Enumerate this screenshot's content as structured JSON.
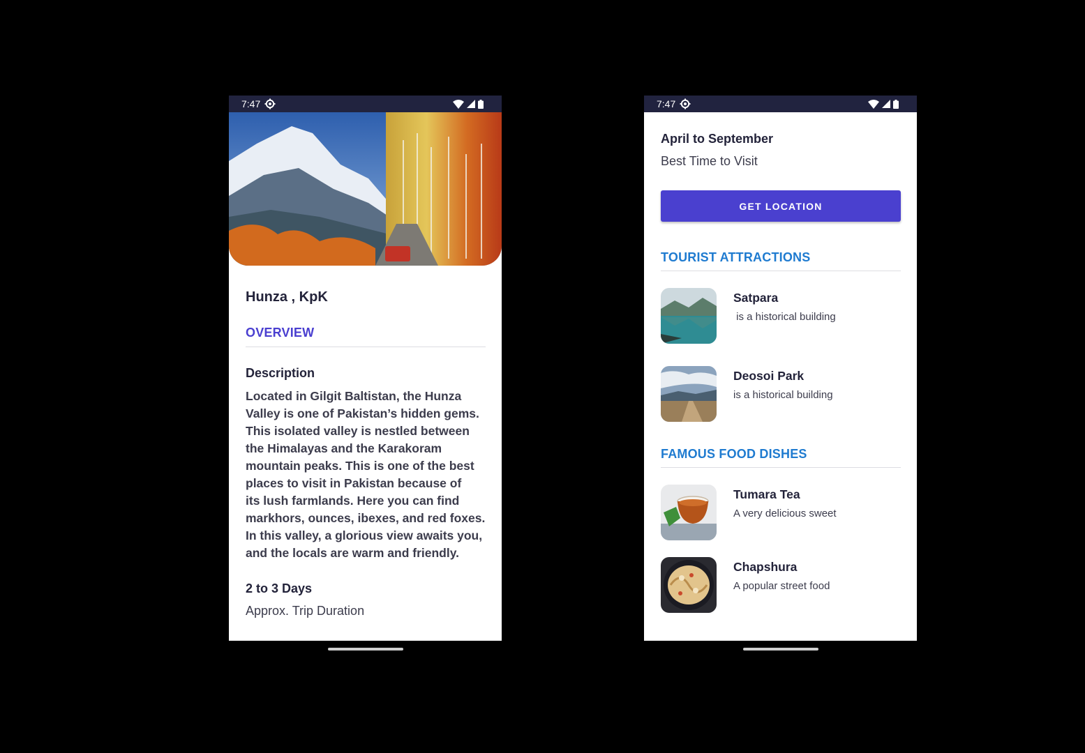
{
  "status_bar": {
    "time": "7:47"
  },
  "left_screen": {
    "hero_image": "Hunza valley mountains with autumn trees",
    "title": "Hunza , KpK",
    "overview_heading": "OVERVIEW",
    "description_label": "Description",
    "description_text": "Located in Gilgit Baltistan, the Hunza\nValley is one of Pakistan’s hidden gems.\nThis isolated valley is nestled between\nthe Himalayas and the Karakoram\nmountain peaks. This is one of the best\nplaces to visit in Pakistan because of\nits lush farmlands. Here you can find\nmarkhors, ounces, ibexes, and red foxes.\nIn this valley, a glorious view awaits you,\nand the locals are warm and friendly.",
    "trip_duration_value": "2 to 3 Days",
    "trip_duration_label": "Approx. Trip Duration"
  },
  "right_screen": {
    "best_time_value": "April to September",
    "best_time_label": "Best Time to Visit",
    "get_location_label": "GET LOCATION",
    "attractions_heading": "TOURIST ATTRACTIONS",
    "attractions": [
      {
        "name": "Satpara",
        "subtitle": " is a historical building",
        "thumb": "lake-photo"
      },
      {
        "name": "Deosoi Park",
        "subtitle": "is a historical building",
        "thumb": "plain-photo"
      }
    ],
    "food_heading": "FAMOUS FOOD DISHES",
    "foods": [
      {
        "name": "Tumara Tea",
        "subtitle": "A very delicious sweet",
        "thumb": "tea-photo"
      },
      {
        "name": "Chapshura",
        "subtitle": "A popular street food",
        "thumb": "pie-photo"
      }
    ]
  },
  "colors": {
    "status_bar": "#21233f",
    "overview_heading": "#4a3fd0",
    "section_heading": "#1f7bd0",
    "button": "#4a40cf",
    "text_dark": "#23233a"
  }
}
